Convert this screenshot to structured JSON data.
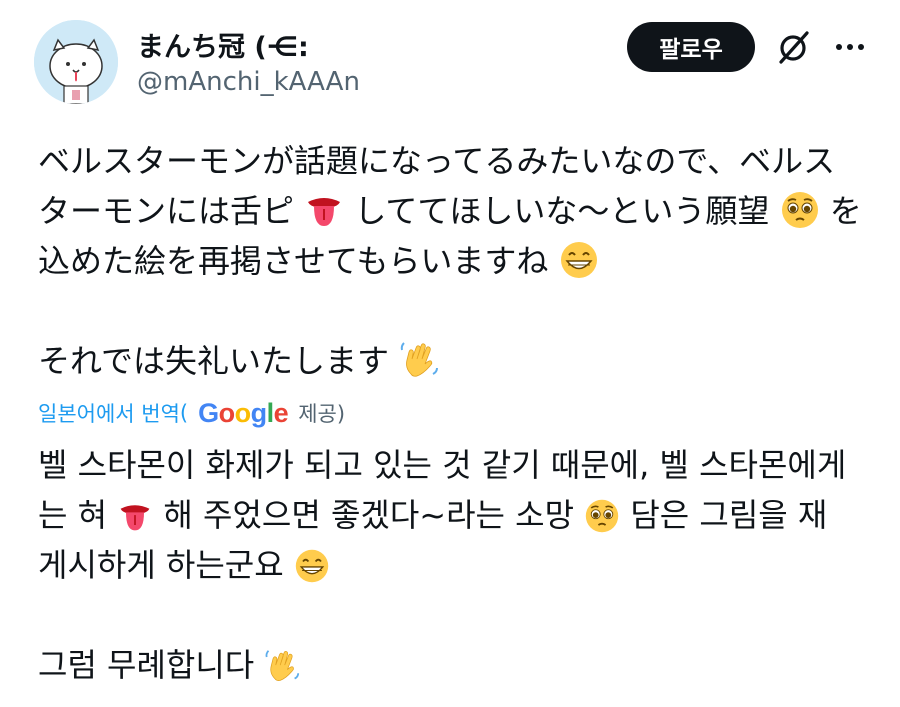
{
  "author": {
    "display_name": "まんち冠 (⋲:",
    "handle": "@mAnchi_kAAAn"
  },
  "actions": {
    "follow_label": "팔로우",
    "grok_icon": "slashed-circle-icon",
    "more_icon": "more-dots-icon"
  },
  "post": {
    "line1": "ベルスターモンが話題になってるみたいなので、ベルス",
    "line2_a": "ターモンには舌ピ",
    "line2_b": "しててほしいな〜という願望",
    "line2_c": "を",
    "line3": "込めた絵を再掲させてもらいますね",
    "line4": "それでは失礼いたします"
  },
  "translation_bar": {
    "label": "일본어에서 번역",
    "open_paren": "(",
    "google": "Google",
    "provided": "제공)"
  },
  "translation": {
    "line1": "벨 스타몬이 화제가 되고 있는 것 같기 때문에, 벨 스타몬에게",
    "line2_a": "는 혀 ",
    "line2_b": " 해 주었으면 좋겠다~라는 소망 ",
    "line2_c": " 담은 그림을 재",
    "line3": "게시하게 하는군요 ",
    "line4": "그럼 무례합니다 "
  },
  "colors": {
    "link_blue": "#1d9bf0",
    "secondary_text": "#536471",
    "follow_bg": "#0f1419"
  }
}
